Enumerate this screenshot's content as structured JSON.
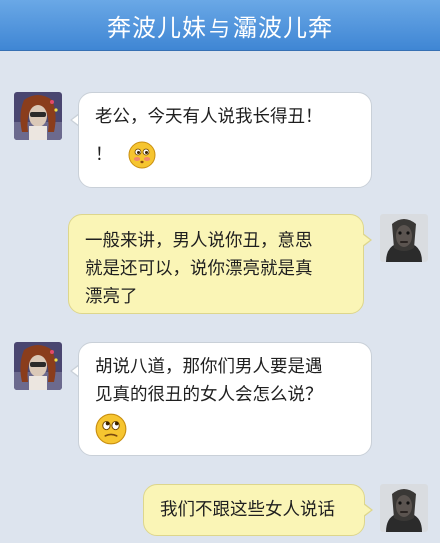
{
  "header": {
    "title_part1": "奔波儿妹",
    "title_joiner": "与",
    "title_part2": "灞波儿奔"
  },
  "messages": [
    {
      "side": "left",
      "line1": "老公，今天有人说我长得丑！",
      "line2_text": "！",
      "emoji": "blushing-face"
    },
    {
      "side": "right",
      "lines": [
        "一般来讲，男人说你丑，意思",
        "就是还可以，说你漂亮就是真",
        "漂亮了"
      ]
    },
    {
      "side": "left",
      "lines": [
        "胡说八道，那你们男人要是遇",
        "见真的很丑的女人会怎么说？"
      ],
      "emoji": "eyes-rolling-face"
    },
    {
      "side": "right",
      "lines": [
        "我们不跟这些女人说话"
      ]
    }
  ],
  "colors": {
    "background": "#dde4ee",
    "title_bar": "#4b8fdb",
    "left_bubble": "#ffffff",
    "right_bubble": "#faf5b6"
  }
}
